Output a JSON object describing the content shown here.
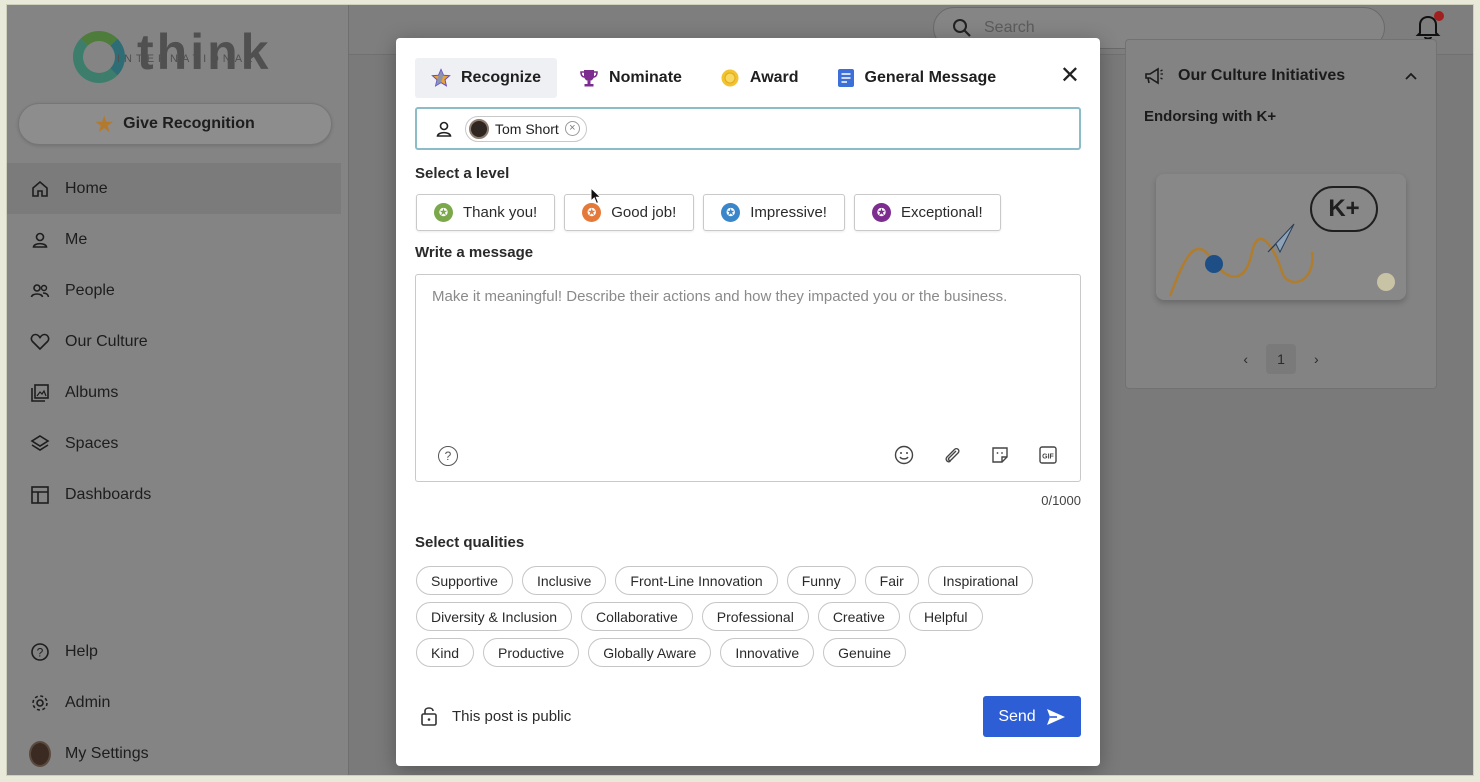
{
  "sidebar": {
    "logo_text": "think",
    "logo_sub": "INTERNATIONAL",
    "give_recognition": "Give Recognition",
    "nav": [
      {
        "label": "Home",
        "icon": "home-icon"
      },
      {
        "label": "Me",
        "icon": "user-icon"
      },
      {
        "label": "People",
        "icon": "people-icon"
      },
      {
        "label": "Our Culture",
        "icon": "heart-icon"
      },
      {
        "label": "Albums",
        "icon": "album-icon"
      },
      {
        "label": "Spaces",
        "icon": "layers-icon"
      },
      {
        "label": "Dashboards",
        "icon": "dashboard-icon"
      }
    ],
    "bottom": [
      {
        "label": "Help",
        "icon": "help-icon"
      },
      {
        "label": "Admin",
        "icon": "gear-icon"
      },
      {
        "label": "My Settings",
        "icon": "avatar"
      }
    ]
  },
  "topbar": {
    "search_placeholder": "Search"
  },
  "right_panel": {
    "title": "Our Culture Initiatives",
    "subtitle": "Endorsing with K+",
    "card_text": "K+",
    "page": "1"
  },
  "modal": {
    "tabs": [
      {
        "label": "Recognize",
        "icon": "star-icon"
      },
      {
        "label": "Nominate",
        "icon": "trophy-icon"
      },
      {
        "label": "Award",
        "icon": "award-icon"
      },
      {
        "label": "General Message",
        "icon": "document-icon"
      }
    ],
    "recipient": "Tom Short",
    "level_label": "Select a level",
    "levels": [
      {
        "label": "Thank you!",
        "color": "#7aa84a"
      },
      {
        "label": "Good job!",
        "color": "#e5793a"
      },
      {
        "label": "Impressive!",
        "color": "#3a86c8"
      },
      {
        "label": "Exceptional!",
        "color": "#7c2d8f"
      }
    ],
    "message_label": "Write a message",
    "message_placeholder": "Make it meaningful! Describe their actions and how they impacted you or the business.",
    "counter": "0/1000",
    "qualities_label": "Select qualities",
    "qualities": [
      [
        "Supportive",
        "Inclusive",
        "Front-Line Innovation",
        "Funny",
        "Fair",
        "Inspirational"
      ],
      [
        "Diversity & Inclusion",
        "Collaborative",
        "Professional",
        "Creative",
        "Helpful"
      ],
      [
        "Kind",
        "Productive",
        "Globally Aware",
        "Innovative",
        "Genuine"
      ]
    ],
    "privacy": "This post is public",
    "send": "Send"
  },
  "colors": {
    "accent": "#2d5ed6",
    "overlay": "#7a7a7a",
    "focus_border": "#8cbcc8"
  }
}
